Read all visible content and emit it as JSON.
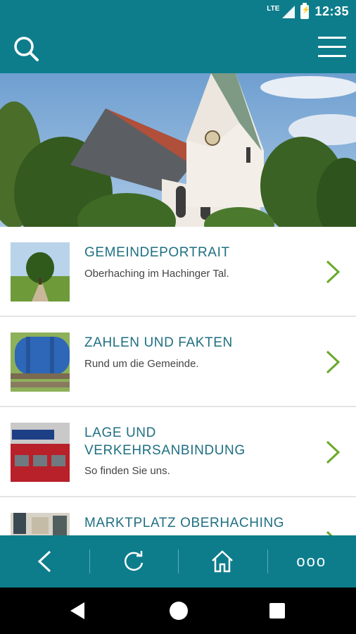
{
  "status_bar": {
    "network": "LTE",
    "time": "12:35"
  },
  "app_bar": {
    "search_icon": "search-icon",
    "menu_icon": "hamburger-menu-icon"
  },
  "hero": {
    "image": "church-with-trees-photo"
  },
  "list": {
    "items": [
      {
        "title": "GEMEINDEPORTRAIT",
        "subtitle": "Oberhaching im Hachinger Tal.",
        "thumb": "tree-landscape-photo"
      },
      {
        "title": "ZAHLEN UND FAKTEN",
        "subtitle": "Rund um die Gemeinde.",
        "thumb": "blue-barrel-photo"
      },
      {
        "title": "LAGE UND VERKEHRSANBINDUNG",
        "subtitle": "So finden Sie uns.",
        "thumb": "train-station-photo"
      },
      {
        "title": "MARKTPLATZ OBERHACHING",
        "subtitle": "",
        "thumb": "marketplace-photo"
      }
    ]
  },
  "bottom_nav": {
    "back_icon": "back-arrow-icon",
    "reload_icon": "reload-icon",
    "home_icon": "home-icon",
    "more_label": "ooo"
  },
  "colors": {
    "primary": "#0d7d8c",
    "title": "#1f6f82",
    "chevron": "#6aa82c"
  }
}
